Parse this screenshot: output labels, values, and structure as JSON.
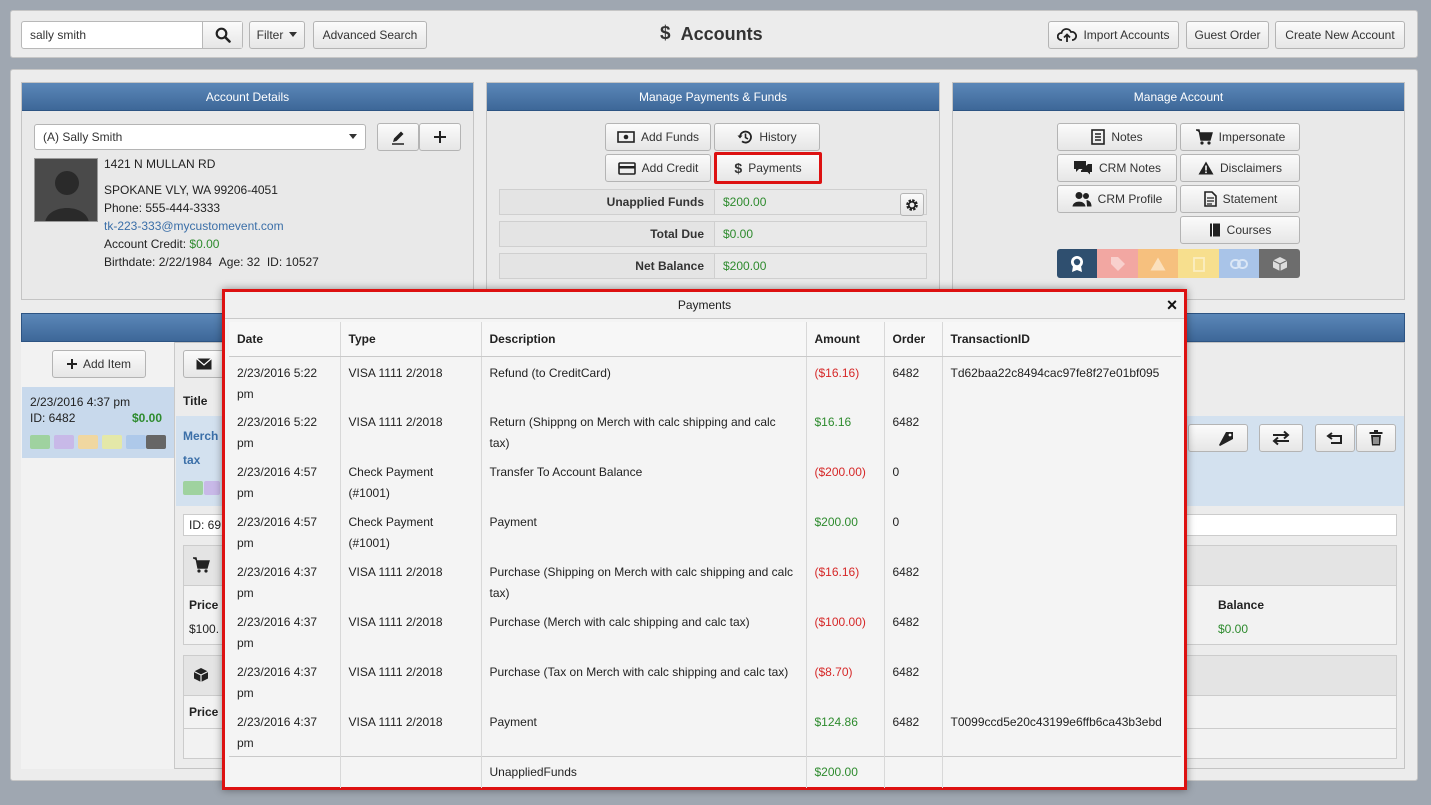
{
  "header": {
    "search_value": "sally smith",
    "filter_label": "Filter",
    "advanced_search_label": "Advanced Search",
    "title": "Accounts",
    "import_label": "Import Accounts",
    "guest_order_label": "Guest Order",
    "create_account_label": "Create New Account"
  },
  "account_details": {
    "heading": "Account Details",
    "selected_account": "(A) Sally Smith",
    "address1": "1421 N MULLAN RD",
    "address2": "SPOKANE VLY, WA 99206-4051",
    "phone": "Phone: 555-444-3333",
    "email": "tk-223-333@mycustomevent.com",
    "credit_label": "Account Credit:",
    "credit_value": "$0.00",
    "birthdate": "Birthdate: 2/22/1984",
    "age": "Age: 32",
    "id": "ID: 10527"
  },
  "manage_payments": {
    "heading": "Manage Payments & Funds",
    "add_funds": "Add Funds",
    "history": "History",
    "add_credit": "Add Credit",
    "payments": "Payments",
    "rows": [
      {
        "label": "Unapplied Funds",
        "value": "$200.00"
      },
      {
        "label": "Total Due",
        "value": "$0.00"
      },
      {
        "label": "Net Balance",
        "value": "$200.00"
      }
    ]
  },
  "manage_account": {
    "heading": "Manage Account",
    "notes": "Notes",
    "impersonate": "Impersonate",
    "crm_notes": "CRM Notes",
    "disclaimers": "Disclaimers",
    "crm_profile": "CRM Profile",
    "statement": "Statement",
    "courses": "Courses"
  },
  "orders": {
    "add_item": "Add Item",
    "order_date": "2/23/2016 4:37 pm",
    "order_id": "ID: 6482",
    "order_total": "$0.00",
    "title_col": "Title",
    "merch_text": "Merch",
    "tax_text": "tax",
    "id_fragment": "ID: 69",
    "price_label": "Price",
    "price_value": "$100.",
    "price_label2": "Price",
    "balance_label": "Balance",
    "balance_value": "$0.00"
  },
  "modal": {
    "title": "Payments",
    "close": "×",
    "columns": [
      "Date",
      "Type",
      "Description",
      "Amount",
      "Order",
      "TransactionID"
    ],
    "rows": [
      {
        "date": "2/23/2016 5:22 pm",
        "type": "VISA 1111 2/2018",
        "description": "Refund (to CreditCard)",
        "amount": "($16.16)",
        "negative": true,
        "order": "6482",
        "transaction": "Td62baa22c8494cac97fe8f27e01bf095"
      },
      {
        "date": "2/23/2016 5:22 pm",
        "type": "VISA 1111 2/2018",
        "description": "Return (Shippng on Merch with calc shipping and calc tax)",
        "amount": "$16.16",
        "negative": false,
        "order": "6482",
        "transaction": ""
      },
      {
        "date": "2/23/2016 4:57 pm",
        "type": "Check Payment (#1001)",
        "description": "Transfer To Account Balance",
        "amount": "($200.00)",
        "negative": true,
        "order": "0",
        "transaction": ""
      },
      {
        "date": "2/23/2016 4:57 pm",
        "type": "Check Payment (#1001)",
        "description": "Payment",
        "amount": "$200.00",
        "negative": false,
        "order": "0",
        "transaction": ""
      },
      {
        "date": "2/23/2016 4:37 pm",
        "type": "VISA 1111 2/2018",
        "description": "Purchase (Shipping on Merch with calc shipping and calc tax)",
        "amount": "($16.16)",
        "negative": true,
        "order": "6482",
        "transaction": ""
      },
      {
        "date": "2/23/2016 4:37 pm",
        "type": "VISA 1111 2/2018",
        "description": "Purchase (Merch with calc shipping and calc tax)",
        "amount": "($100.00)",
        "negative": true,
        "order": "6482",
        "transaction": ""
      },
      {
        "date": "2/23/2016 4:37 pm",
        "type": "VISA 1111 2/2018",
        "description": "Purchase (Tax on Merch with calc shipping and calc tax)",
        "amount": "($8.70)",
        "negative": true,
        "order": "6482",
        "transaction": ""
      },
      {
        "date": "2/23/2016 4:37 pm",
        "type": "VISA 1111 2/2018",
        "description": "Payment",
        "amount": "$124.86",
        "negative": false,
        "order": "6482",
        "transaction": "T0099ccd5e20c43199e6ffb6ca43b3ebd"
      }
    ],
    "footer_label": "UnappliedFunds",
    "footer_amount": "$200.00"
  },
  "colors": {
    "panel_header": "#3d6798",
    "highlight_border": "#dd1111",
    "positive": "#2e8b2e",
    "negative": "#d62828",
    "link": "#3b6fa8"
  }
}
